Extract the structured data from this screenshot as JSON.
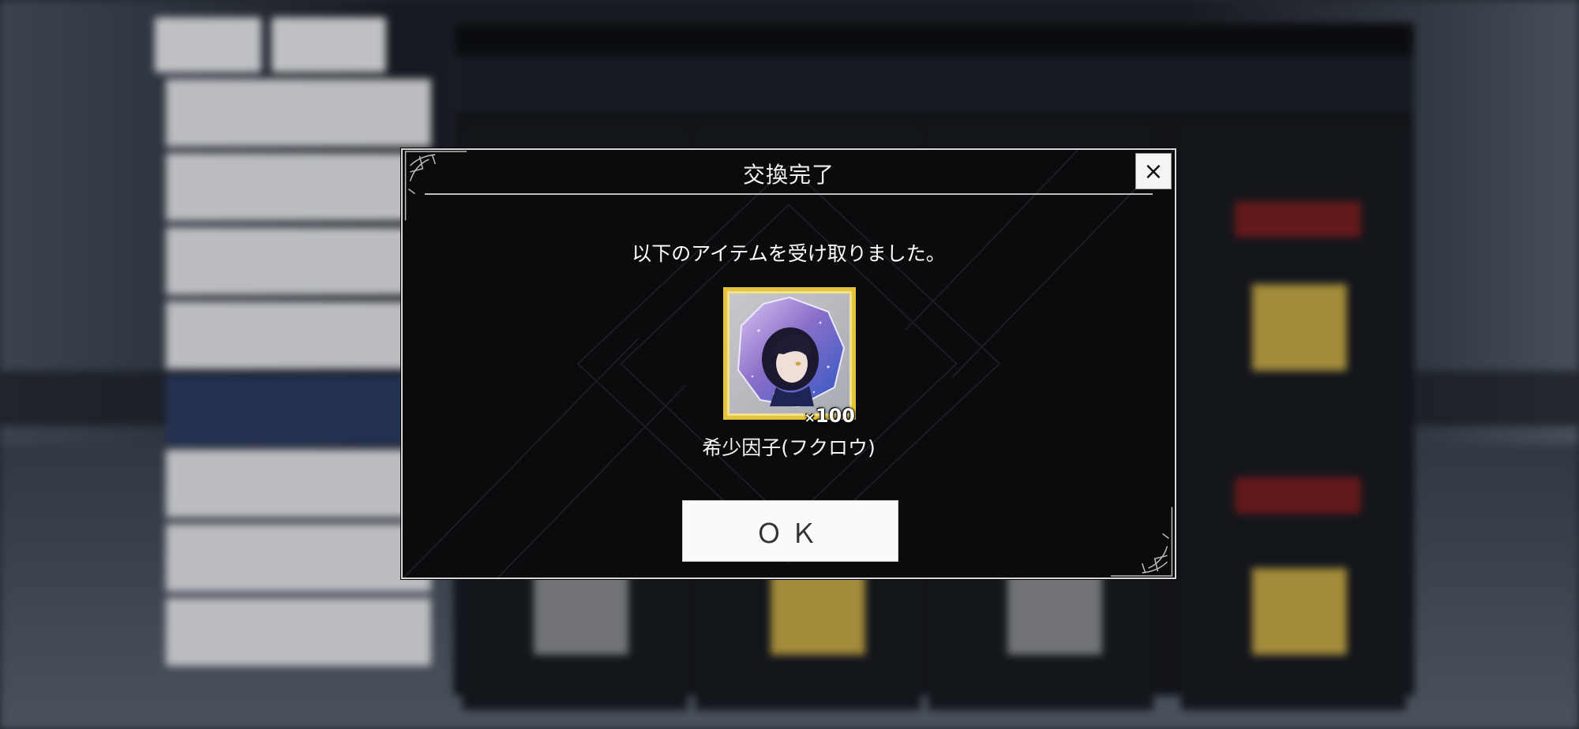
{
  "dialog": {
    "title": "交換完了",
    "close_label": "×",
    "message": "以下のアイテムを受け取りました。",
    "item": {
      "name": "希少因子(フクロウ)",
      "quantity_prefix": "×",
      "quantity": "100",
      "icon": "rare-factor-owl-crystal-icon"
    },
    "ok_label": "ＯＫ"
  },
  "colors": {
    "modal_bg": "#0b0b0d",
    "frame_gold": "#e3c43a",
    "button_bg": "#fafafa",
    "background_accent_red": "#7a1f22",
    "sidebar_active": "#2b3c66"
  }
}
